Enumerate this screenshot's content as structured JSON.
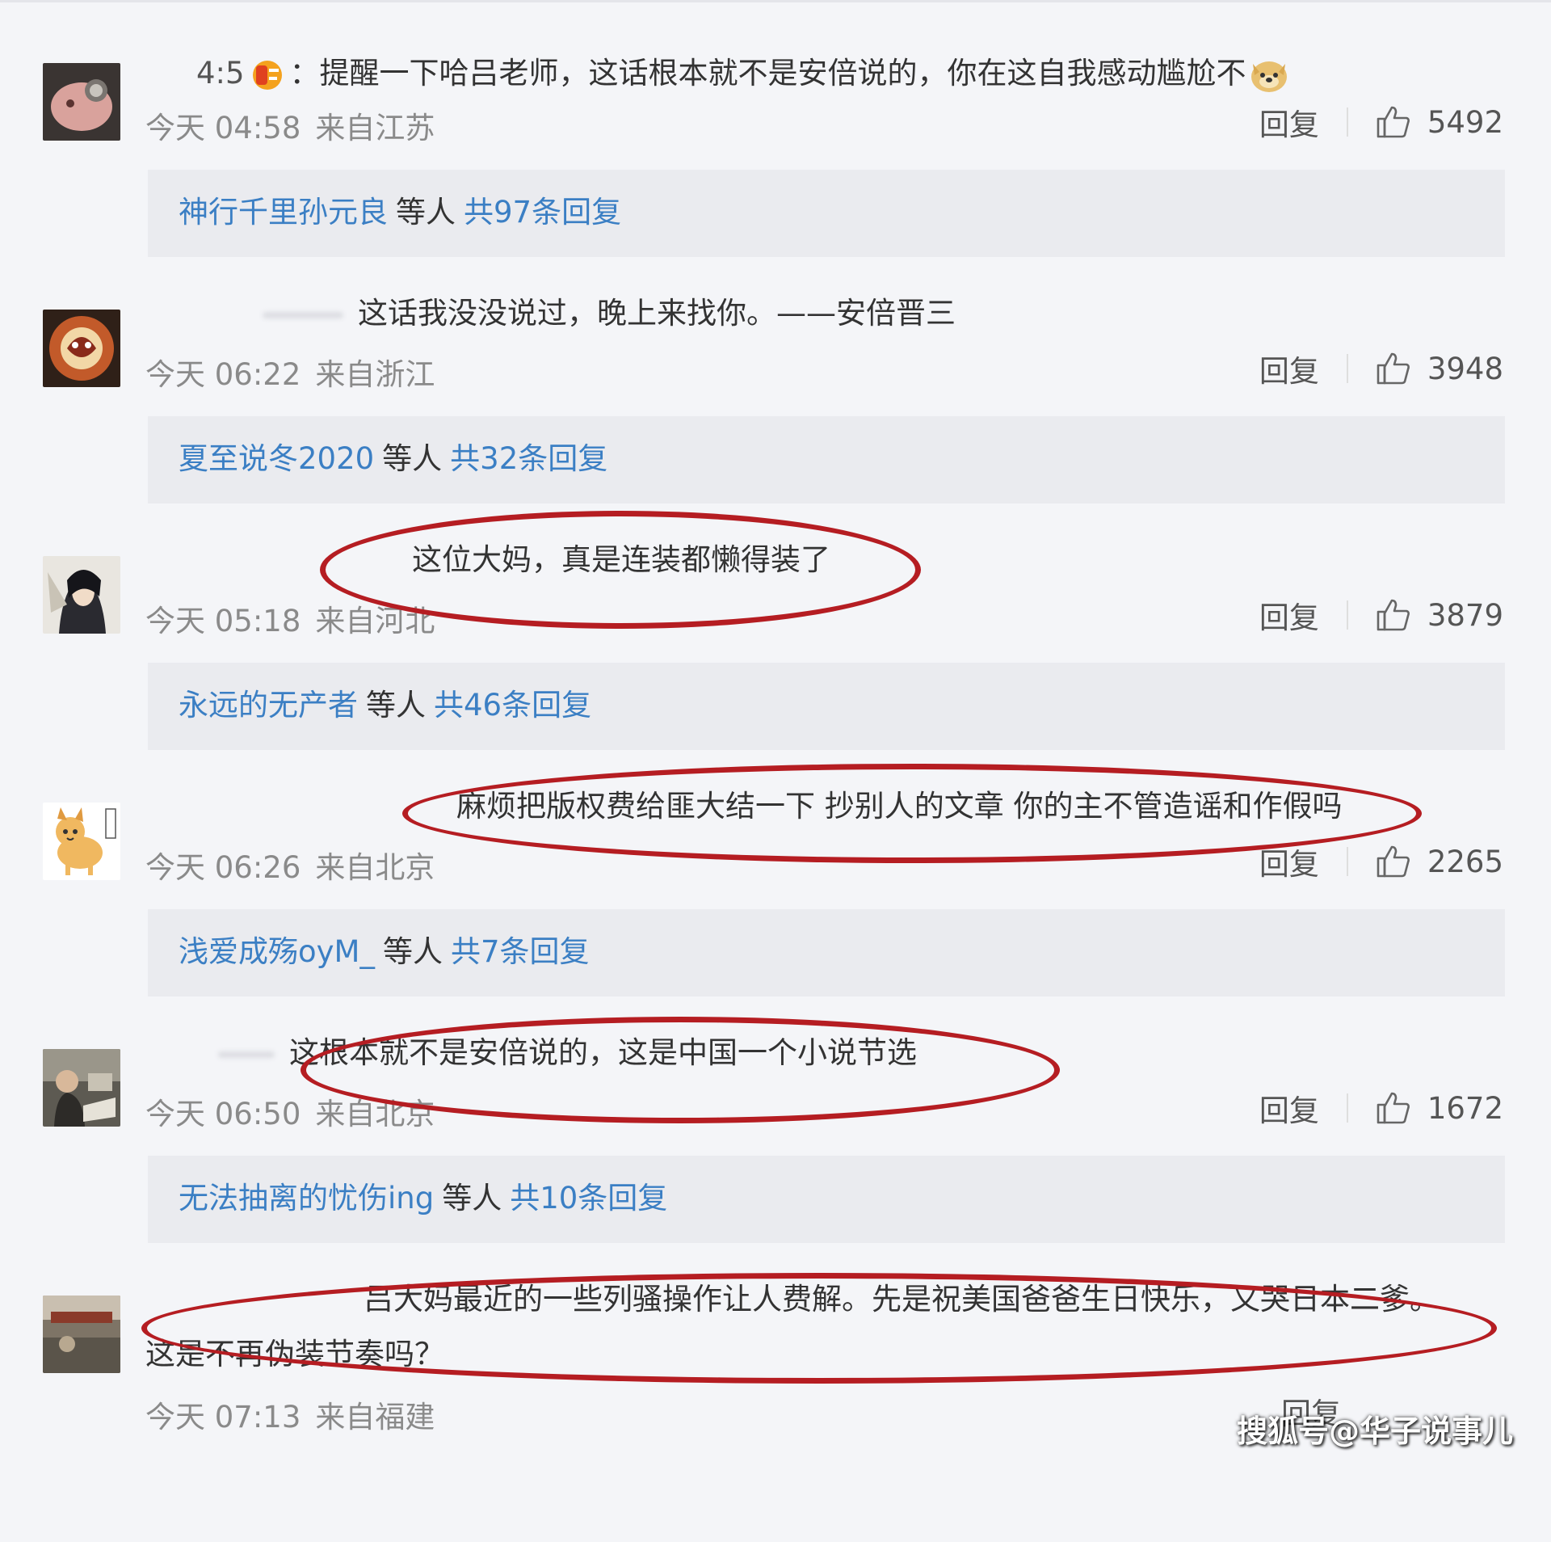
{
  "comments": [
    {
      "prefix": "4:5",
      "text": "：提醒一下哈吕老师，这话根本就不是安倍说的，你在这自我感动尴尬不",
      "time": "今天 04:58",
      "location": "来自江苏",
      "reply_label": "回复",
      "likes": "5492",
      "reply_names": "神行千里孙元良",
      "reply_mid": "等人",
      "reply_total": "共97条回复"
    },
    {
      "text": "这话我没没说过，晚上来找你。——安倍晋三",
      "time": "今天 06:22",
      "location": "来自浙江",
      "reply_label": "回复",
      "likes": "3948",
      "reply_names": "夏至说冬2020",
      "reply_mid": "等人",
      "reply_total": "共32条回复"
    },
    {
      "text": "这位大妈，真是连装都懒得装了",
      "time": "今天 05:18",
      "location": "来自河北",
      "reply_label": "回复",
      "likes": "3879",
      "reply_names": "永远的无产者",
      "reply_mid": "等人",
      "reply_total": "共46条回复"
    },
    {
      "text": "麻烦把版权费给匪大结一下 抄别人的文章 你的主不管造谣和作假吗",
      "time": "今天 06:26",
      "location": "来自北京",
      "reply_label": "回复",
      "likes": "2265",
      "reply_names": "浅爱成殇oyM_",
      "reply_mid": "等人",
      "reply_total": "共7条回复"
    },
    {
      "text": "这根本就不是安倍说的，这是中国一个小说节选",
      "time": "今天 06:50",
      "location": "来自北京",
      "reply_label": "回复",
      "likes": "1672",
      "reply_names": "无法抽离的忧伤ing",
      "reply_mid": "等人",
      "reply_total": "共10条回复"
    },
    {
      "text": "吕大妈最近的一些列骚操作让人费解。先是祝美国爸爸生日快乐，又哭日本二爹。",
      "text_cont": "这是不再伪装节奏吗？",
      "time": "今天 07:13",
      "location": "来自福建",
      "reply_label": "回复"
    }
  ],
  "watermark": "搜狐号@华子说事儿",
  "colors": {
    "background": "#f4f5f8",
    "link": "#3b7fc4",
    "highlight": "#b51d22",
    "meta": "#8a8a8a"
  }
}
